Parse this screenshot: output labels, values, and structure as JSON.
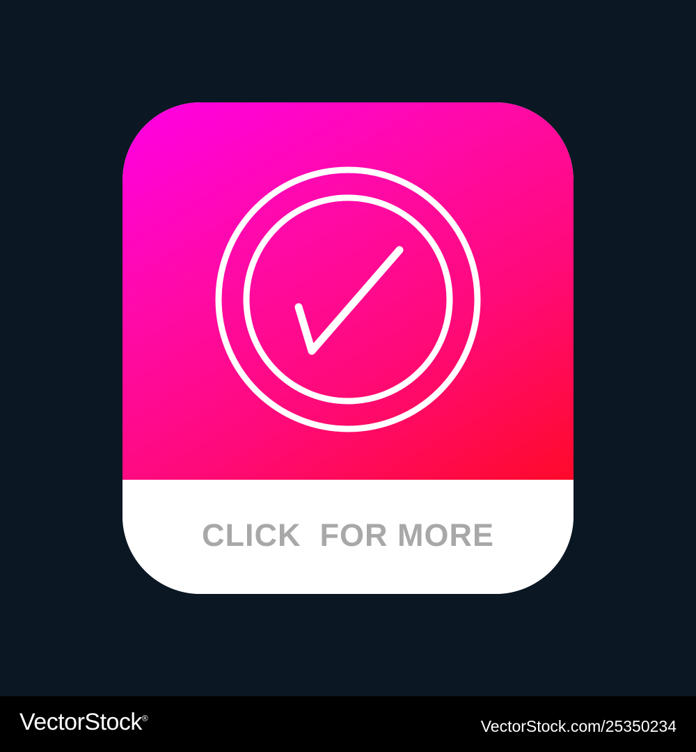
{
  "icon": {
    "cta_label": "CLICK  FOR MORE",
    "glyph": "checkmark-circle-icon",
    "gradient_colors": [
      "#ff00e6",
      "#ff0a2a"
    ],
    "foreground_color": "#ffffff",
    "label_color": "#a8a8a8"
  },
  "footer": {
    "brand": "VectorStock",
    "brand_mark": "®",
    "stock_id": "VectorStock.com/25350234"
  },
  "colors": {
    "background": "#0b1723",
    "footer_background": "#000000"
  }
}
